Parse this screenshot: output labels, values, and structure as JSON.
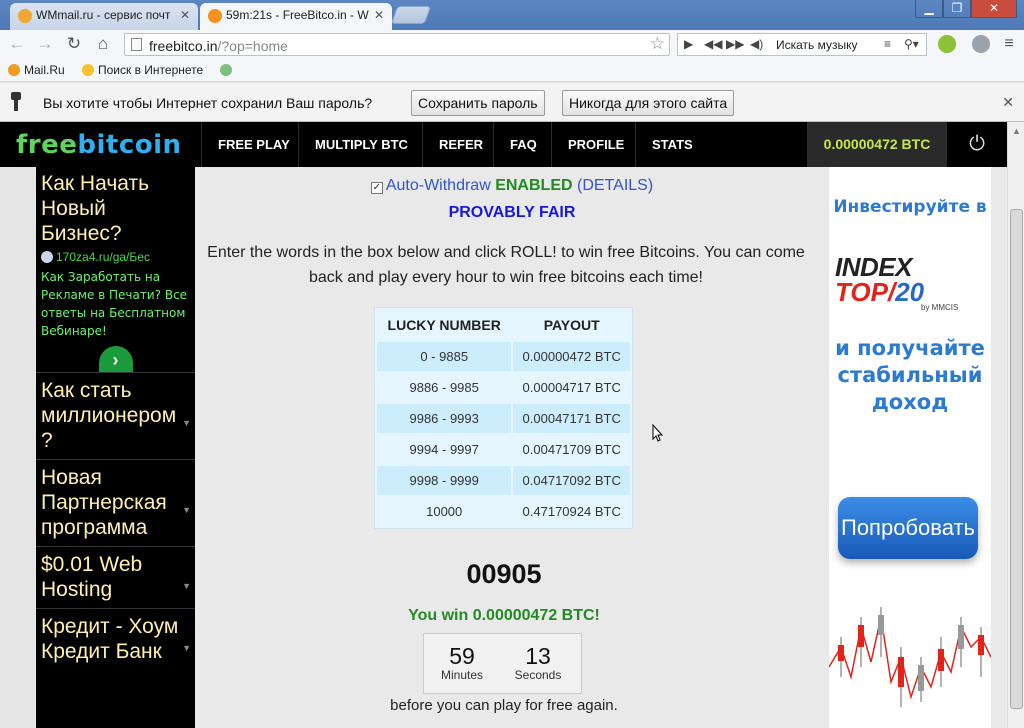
{
  "browser": {
    "tabs": [
      {
        "title": "WMmail.ru - сервис почт",
        "active": false
      },
      {
        "title": "59m:21s - FreeBitco.in - W",
        "active": true
      }
    ],
    "url_host": "freebitco.in",
    "url_path": "/?op=home",
    "music_search_label": "Искать музыку",
    "bookmarks": [
      "Mail.Ru",
      "Поиск в Интернете"
    ],
    "infobar": {
      "message": "Вы хотите чтобы Интернет сохранил Ваш пароль?",
      "save_label": "Сохранить пароль",
      "never_label": "Никогда для этого сайта"
    }
  },
  "site": {
    "logo_part1": "free",
    "logo_part2": "bitcoin",
    "nav": [
      "FREE PLAY",
      "MULTIPLY BTC",
      "REFER",
      "FAQ",
      "PROFILE",
      "STATS"
    ],
    "balance": "0.00000472 BTC"
  },
  "left_ad": {
    "headline": "Как Начать Новый Бизнес?",
    "link": "170za4.ru/ga/Бес",
    "description": "Как Заработать на Рекламе в Печати? Все ответы на Бесплатном Вебинаре!",
    "items": [
      "Как стать миллионером ?",
      "Новая Партнерская программа",
      "$0.01 Web Hosting",
      "Кредит - Хоум Кредит Банк"
    ]
  },
  "right_ad": {
    "headline": "Инвестируйте в",
    "brand_index": "INDEX",
    "brand_top": "TOP",
    "brand_num": "20",
    "brand_by": "by MMCIS",
    "text": "и получайте стабильный доход",
    "button": "Попробовать"
  },
  "main": {
    "checkbox_mark": "✓",
    "auto_withdraw": "Auto-Withdraw",
    "enabled": "ENABLED",
    "details": "DETAILS",
    "provably_fair": "PROVABLY FAIR",
    "intro": "Enter the words in the box below and click ROLL! to win free Bitcoins. You can come back and play every hour to win free bitcoins each time!",
    "table_headers": [
      "LUCKY NUMBER",
      "PAYOUT"
    ],
    "table_rows": [
      [
        "0 - 9885",
        "0.00000472 BTC"
      ],
      [
        "9886 - 9985",
        "0.00004717 BTC"
      ],
      [
        "9986 - 9993",
        "0.00047171 BTC"
      ],
      [
        "9994 - 9997",
        "0.00471709 BTC"
      ],
      [
        "9998 - 9999",
        "0.04717092 BTC"
      ],
      [
        "10000",
        "0.47170924 BTC"
      ]
    ],
    "roll_result": "00905",
    "win_message": "You win 0.00000472 BTC!",
    "timer": {
      "minutes": "59",
      "minutes_label": "Minutes",
      "seconds": "13",
      "seconds_label": "Seconds"
    },
    "again_text": "before you can play for free again."
  }
}
